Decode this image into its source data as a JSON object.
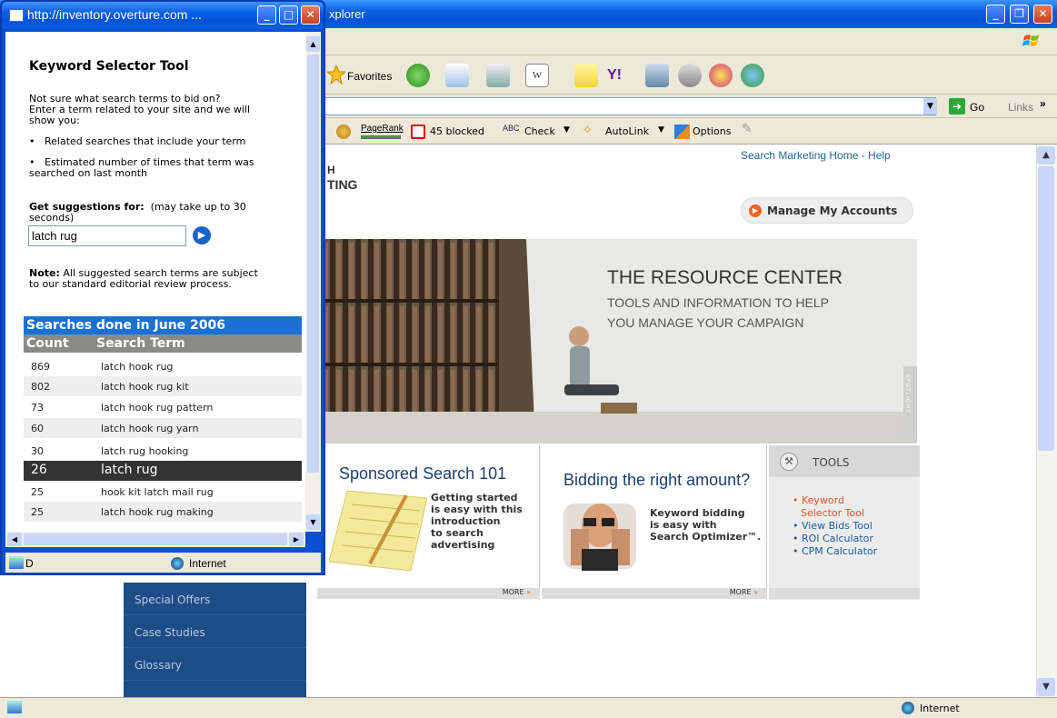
{
  "browser": {
    "title": "xplorer",
    "menu_favorites": "Favorites",
    "go_label": "Go",
    "links_label": "Links",
    "links_chevron": "»",
    "toolbar": {
      "pagerank": "PageRank",
      "blocked": "45 blocked",
      "check": "Check",
      "autolink": "AutoLink",
      "options": "Options"
    },
    "status_zone": "Internet"
  },
  "page": {
    "top_links": "Search Marketing Home - Help",
    "logo_fragment_h": "H",
    "logo_fragment_ting": "TING",
    "manage_accounts": "Manage My Accounts",
    "hero": {
      "title": "THE RESOURCE CENTER",
      "sub1": "TOOLS AND INFORMATION TO HELP",
      "sub2": "YOU MANAGE YOUR CAMPAIGN",
      "spotlight": "SPOTLIGHT"
    },
    "box1": {
      "title": "Sponsored Search 101",
      "lines": [
        "Getting started",
        "is easy with this",
        "introduction",
        "to search",
        "advertising"
      ],
      "more": "MORE"
    },
    "box2": {
      "title": "Bidding the right amount?",
      "lines": [
        "Keyword bidding",
        "is easy with",
        "Search Optimizer™."
      ],
      "more": "MORE"
    },
    "tools": {
      "title": "TOOLS",
      "items": [
        "• Keyword",
        "Selector Tool",
        "• View Bids Tool",
        "• ROI Calculator",
        "• CPM Calculator"
      ]
    },
    "sidenav": [
      "Special Offers",
      "Case Studies",
      "Glossary"
    ]
  },
  "popup": {
    "title": "http://inventory.overture.com ...",
    "heading": "Keyword Selector Tool",
    "intro1": "Not sure what search terms to bid on?",
    "intro2": "Enter a term related to your site and we will",
    "intro3": "show you:",
    "bullet1": "Related searches that include your term",
    "bullet2a": "Estimated number of times that term was",
    "bullet2b": "searched on last month",
    "suggest_label": "Get suggestions for:",
    "suggest_note1": "(may take up to 30",
    "suggest_note2": "seconds)",
    "search_value": "latch rug",
    "note_label": "Note:",
    "note1": "All suggested search terms are subject",
    "note2": "to our standard editorial review process.",
    "results_title": "Searches done in June 2006",
    "col_count": "Count",
    "col_term": "Search Term",
    "rows": [
      {
        "count": "869",
        "term": "latch hook rug"
      },
      {
        "count": "802",
        "term": "latch hook rug kit"
      },
      {
        "count": "73",
        "term": "latch hook rug pattern"
      },
      {
        "count": "60",
        "term": "latch hook rug yarn"
      },
      {
        "count": "30",
        "term": "latch rug hooking"
      },
      {
        "count": "26",
        "term": "latch rug"
      },
      {
        "count": "25",
        "term": "hook kit latch mail rug"
      },
      {
        "count": "25",
        "term": "latch hook rug making"
      }
    ],
    "status_left": "D",
    "status_zone": "Internet"
  }
}
